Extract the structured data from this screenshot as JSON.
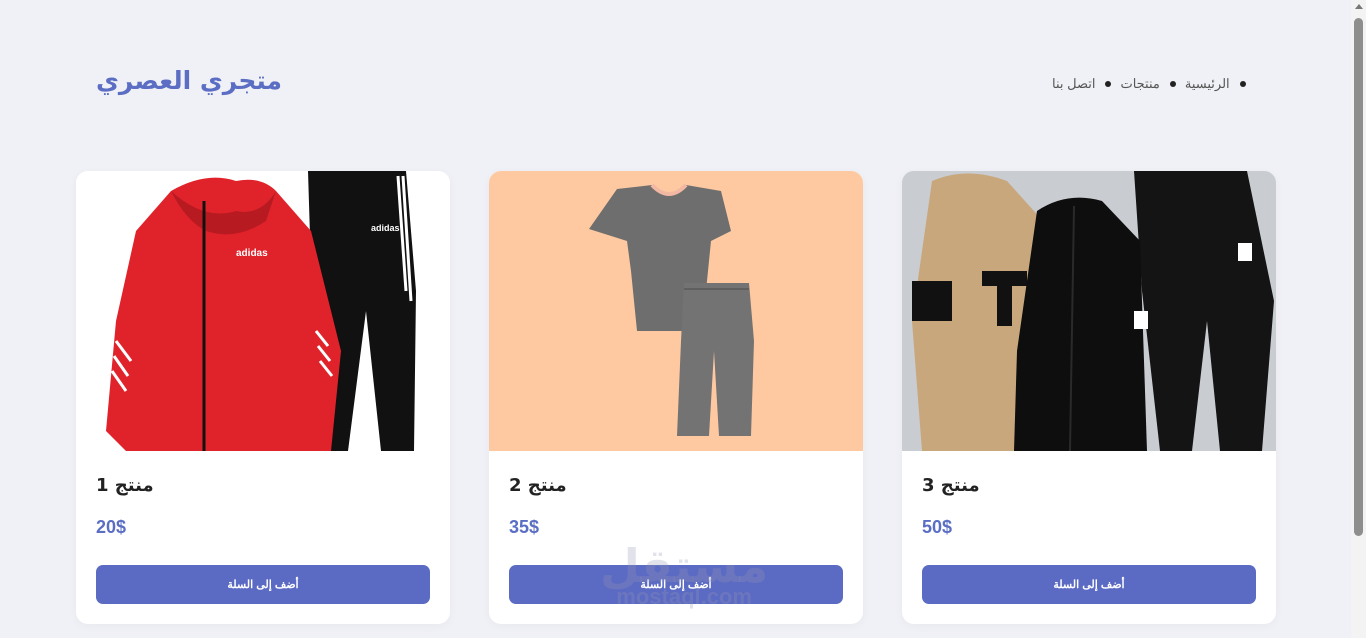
{
  "header": {
    "logo": "متجري العصري",
    "nav": [
      {
        "label": "الرئيسية"
      },
      {
        "label": "منتجات"
      },
      {
        "label": "اتصل بنا"
      }
    ]
  },
  "products": [
    {
      "name": "منتج 1",
      "price": "20$",
      "button": "أضف إلى السلة",
      "image": "red-tracksuit"
    },
    {
      "name": "منتج 2",
      "price": "35$",
      "button": "أضف إلى السلة",
      "image": "grey-pajama-set"
    },
    {
      "name": "منتج 3",
      "price": "50$",
      "button": "أضف إلى السلة",
      "image": "beige-black-tracksuit"
    }
  ],
  "watermark": {
    "arabic": "مستقل",
    "latin": "mostaql.com"
  },
  "colors": {
    "accent": "#5b6ac3",
    "background": "#f0f1f6",
    "card": "#ffffff"
  }
}
